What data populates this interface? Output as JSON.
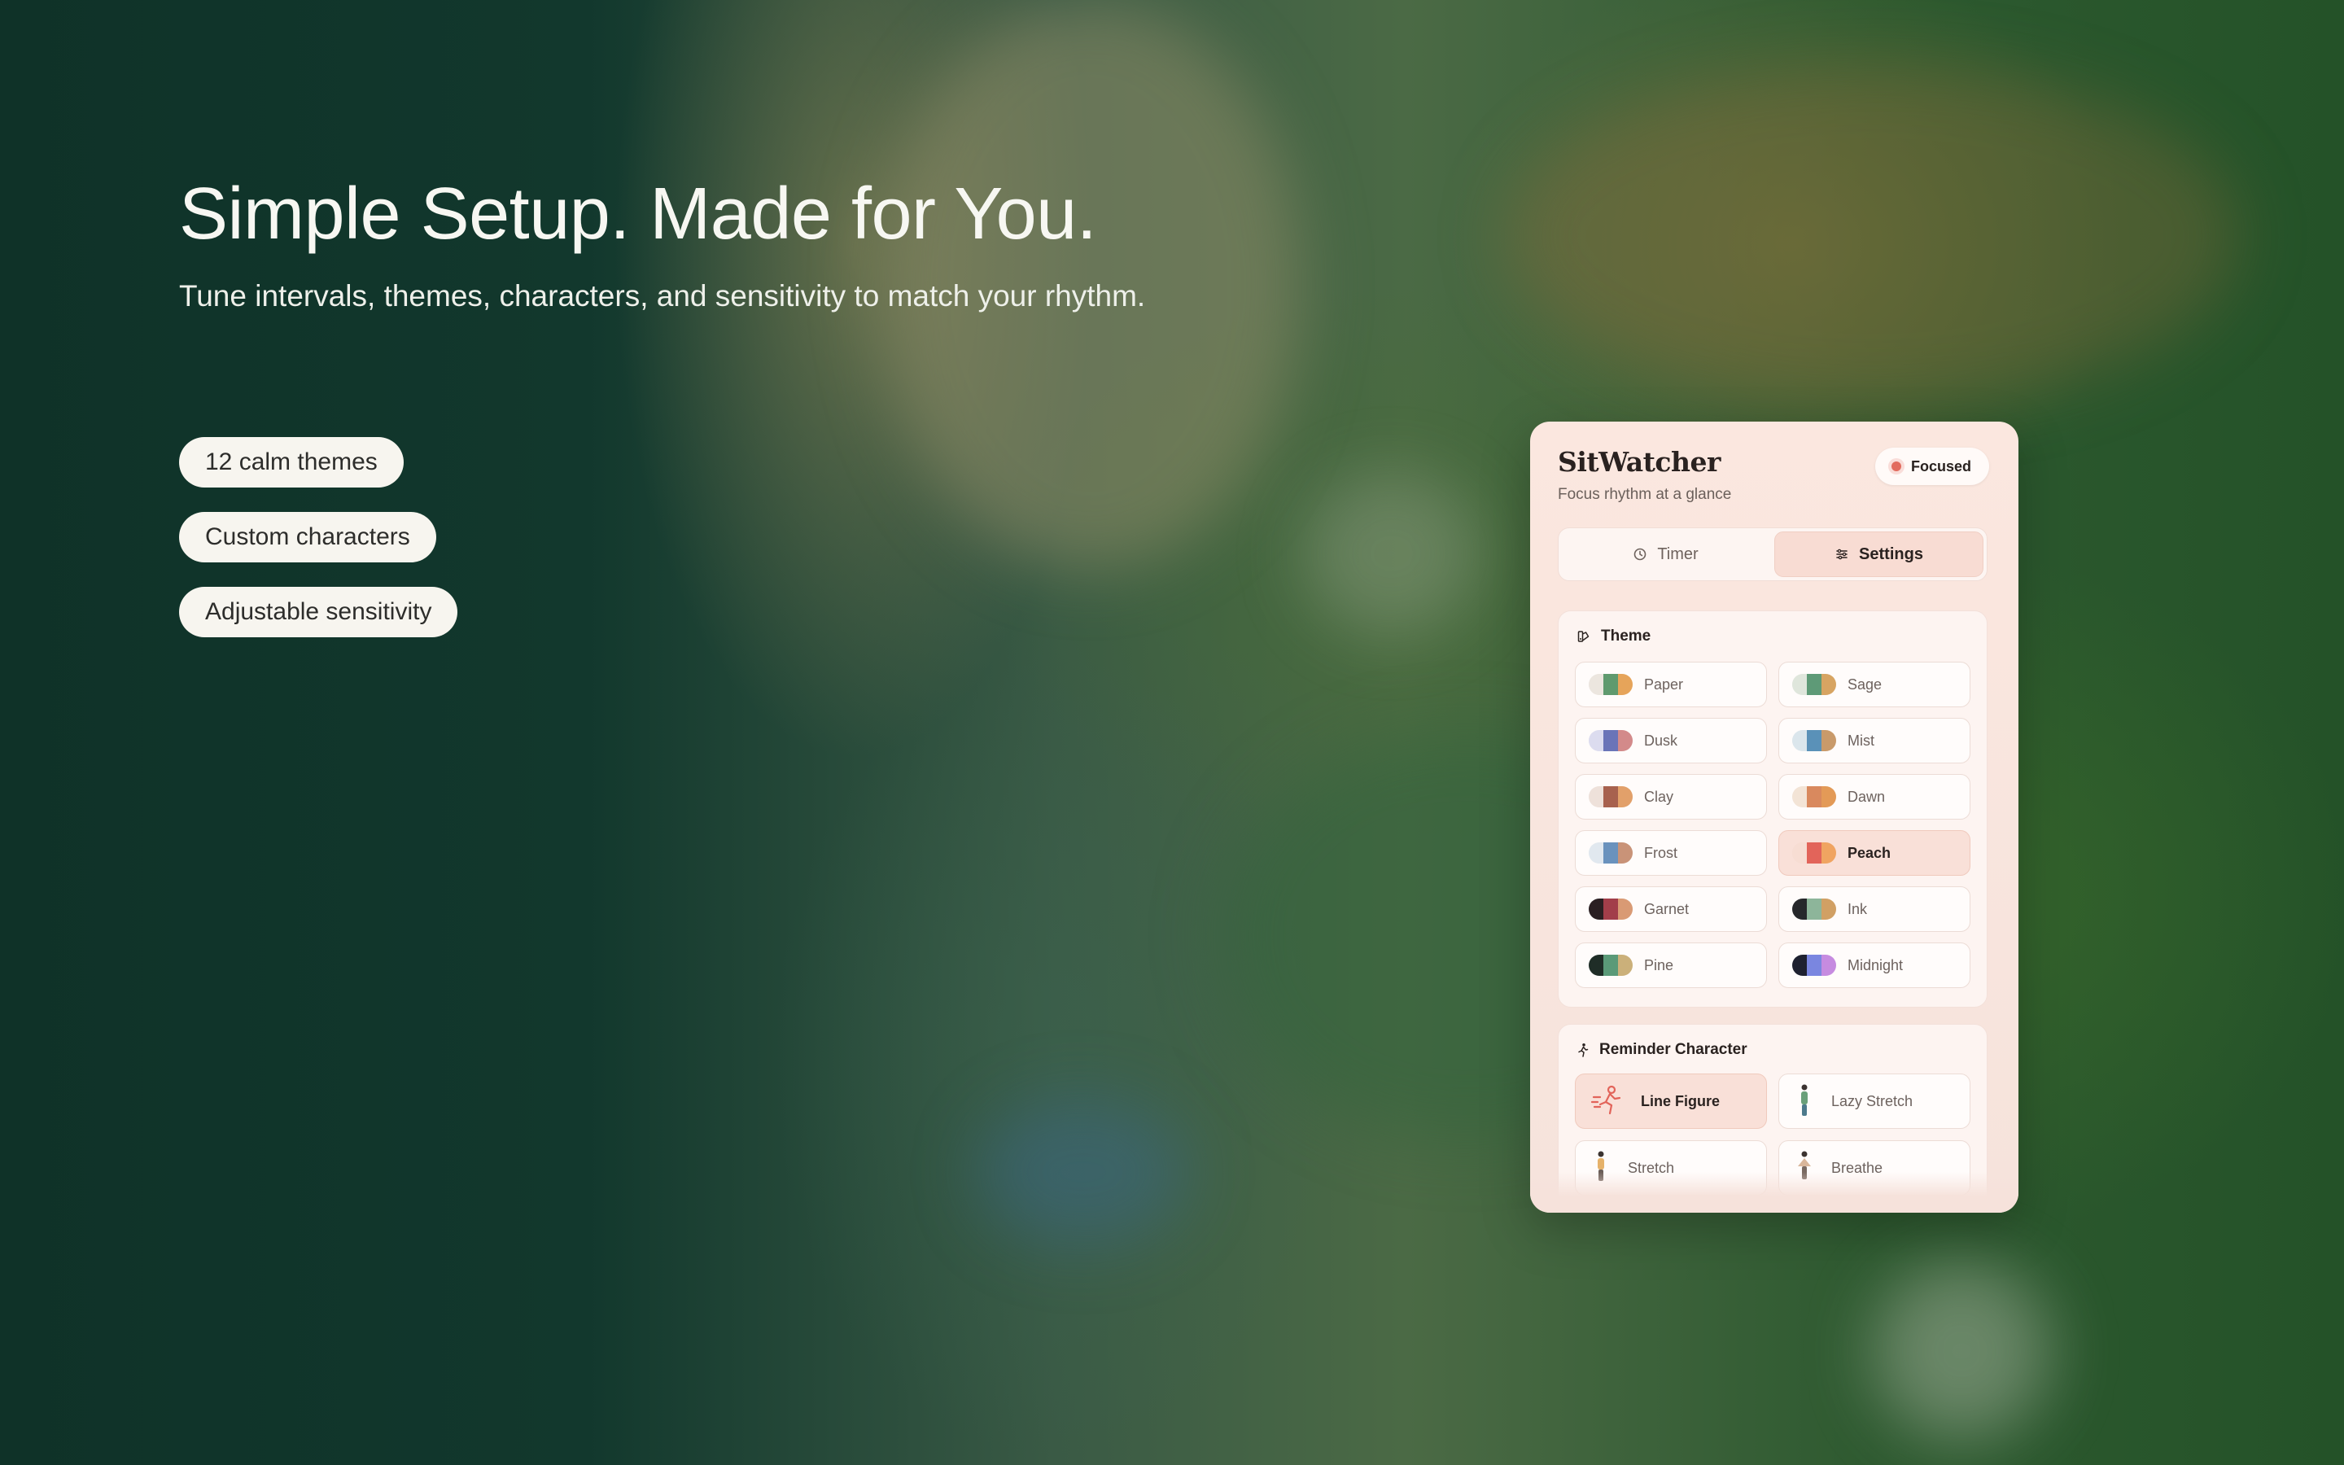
{
  "hero": {
    "title": "Simple Setup. Made for You.",
    "subtitle": "Tune intervals, themes, characters, and sensitivity to match your rhythm."
  },
  "features": [
    "12 calm themes",
    "Custom characters",
    "Adjustable sensitivity"
  ],
  "app": {
    "name": "SitWatcher",
    "tagline": "Focus rhythm at a glance",
    "status": "Focused",
    "status_color": "#e26b5e",
    "tabs": [
      {
        "label": "Timer",
        "icon": "timer-icon",
        "active": false
      },
      {
        "label": "Settings",
        "icon": "sliders-icon",
        "active": true
      }
    ],
    "theme_section": {
      "title": "Theme",
      "icon": "palette-icon",
      "themes": [
        {
          "label": "Paper",
          "colors": [
            "#ece6df",
            "#5f9a6e",
            "#e6a45a"
          ]
        },
        {
          "label": "Sage",
          "colors": [
            "#dfe6dc",
            "#5e9a77",
            "#d7a462"
          ]
        },
        {
          "label": "Dusk",
          "colors": [
            "#dcdcef",
            "#6a74b8",
            "#d38a8a"
          ]
        },
        {
          "label": "Mist",
          "colors": [
            "#dbe6ec",
            "#5a91b8",
            "#c99a6a"
          ]
        },
        {
          "label": "Clay",
          "colors": [
            "#eee1da",
            "#a7614e",
            "#e2a06a"
          ]
        },
        {
          "label": "Dawn",
          "colors": [
            "#f3e4d6",
            "#d9895e",
            "#e39a57"
          ]
        },
        {
          "label": "Frost",
          "colors": [
            "#e1e8ef",
            "#6a92bd",
            "#c99378"
          ]
        },
        {
          "label": "Peach",
          "colors": [
            "#f7ddd3",
            "#e2645a",
            "#f0a461"
          ]
        },
        {
          "label": "Garnet",
          "colors": [
            "#2a1f22",
            "#a23e4a",
            "#d99a74"
          ]
        },
        {
          "label": "Ink",
          "colors": [
            "#26282b",
            "#8db59a",
            "#d1a064"
          ]
        },
        {
          "label": "Pine",
          "colors": [
            "#1f2d27",
            "#5a9a78",
            "#cbb07a"
          ]
        },
        {
          "label": "Midnight",
          "colors": [
            "#1e2130",
            "#7a86e0",
            "#c68be0"
          ]
        }
      ],
      "selected": "Peach"
    },
    "character_section": {
      "title": "Reminder Character",
      "icon": "walking-person-icon",
      "characters": [
        {
          "label": "Line Figure",
          "active": true
        },
        {
          "label": "Lazy Stretch",
          "active": false
        },
        {
          "label": "Stretch",
          "active": false
        },
        {
          "label": "Breathe",
          "active": false
        }
      ]
    }
  }
}
